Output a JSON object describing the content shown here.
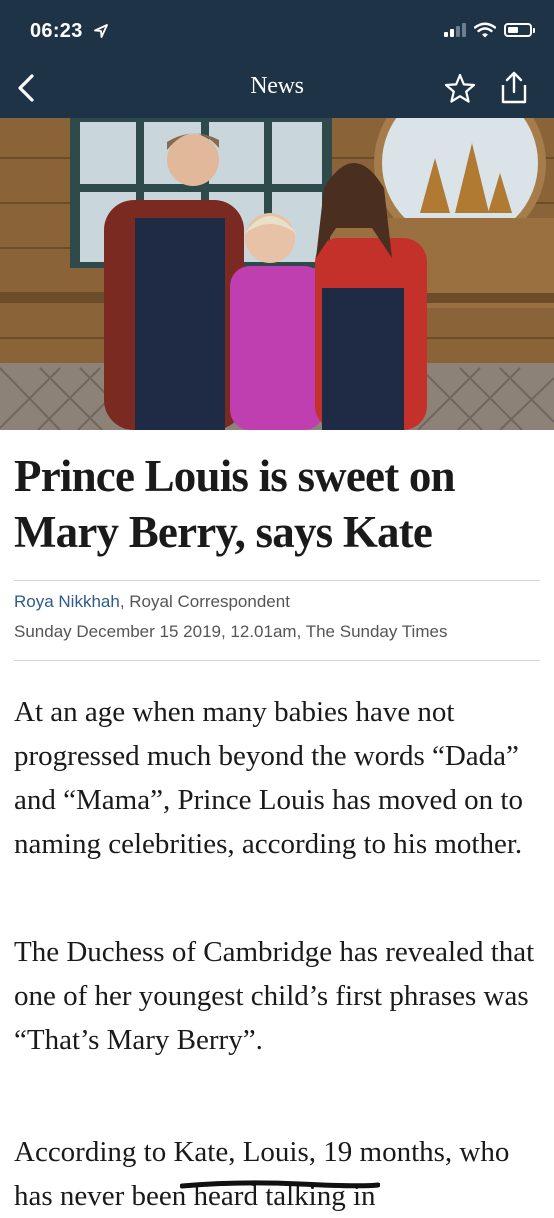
{
  "status_bar": {
    "time": "06:23",
    "icons": [
      "location-arrow-icon",
      "signal-icon",
      "wifi-icon",
      "battery-icon"
    ]
  },
  "nav": {
    "title": "News",
    "icons": {
      "back": "chevron-left-icon",
      "bookmark": "star-icon",
      "share": "share-icon"
    }
  },
  "article": {
    "headline": "Prince Louis is sweet on Mary Berry, says Kate",
    "author": "Roya Nikkhah",
    "author_role": ", Royal Correspondent",
    "dateline": "Sunday December 15 2019, 12.01am, The Sunday Times",
    "paragraphs": [
      "At an age when many babies have not progressed much beyond the words “Dada” and “Mama”, Prince Louis has moved on to naming celebrities, according to his mother.",
      "The Duchess of Cambridge has revealed that one of her youngest child’s first phrases was “That’s Mary Berry”.",
      "According to Kate, Louis, 19 months, who has never been heard talking in"
    ]
  },
  "colors": {
    "header_bg": "#1f3347",
    "author_link": "#2d5b8a",
    "text": "#1a1a1a",
    "meta_text": "#555555"
  }
}
